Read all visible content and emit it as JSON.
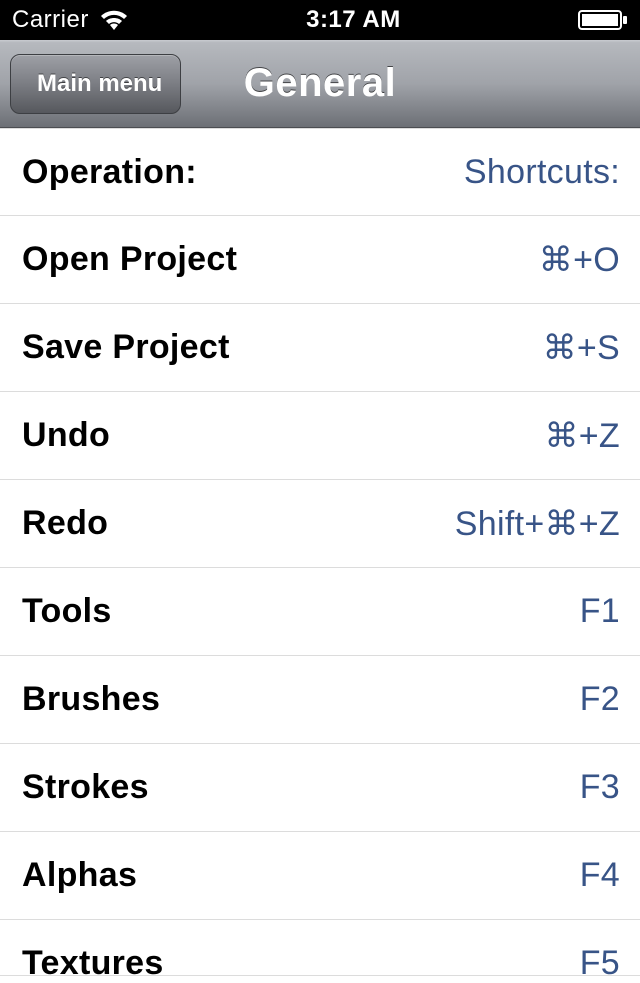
{
  "status": {
    "carrier": "Carrier",
    "time": "3:17 AM"
  },
  "nav": {
    "back_label": "Main menu",
    "title": "General"
  },
  "header": {
    "operation_label": "Operation:",
    "shortcuts_label": "Shortcuts:"
  },
  "rows": [
    {
      "label": "Open Project",
      "shortcut": "⌘+O"
    },
    {
      "label": "Save Project",
      "shortcut": "⌘+S"
    },
    {
      "label": "Undo",
      "shortcut": "⌘+Z"
    },
    {
      "label": "Redo",
      "shortcut": "Shift+⌘+Z"
    },
    {
      "label": "Tools",
      "shortcut": "F1"
    },
    {
      "label": "Brushes",
      "shortcut": "F2"
    },
    {
      "label": "Strokes",
      "shortcut": "F3"
    },
    {
      "label": "Alphas",
      "shortcut": "F4"
    },
    {
      "label": "Textures",
      "shortcut": "F5"
    }
  ]
}
